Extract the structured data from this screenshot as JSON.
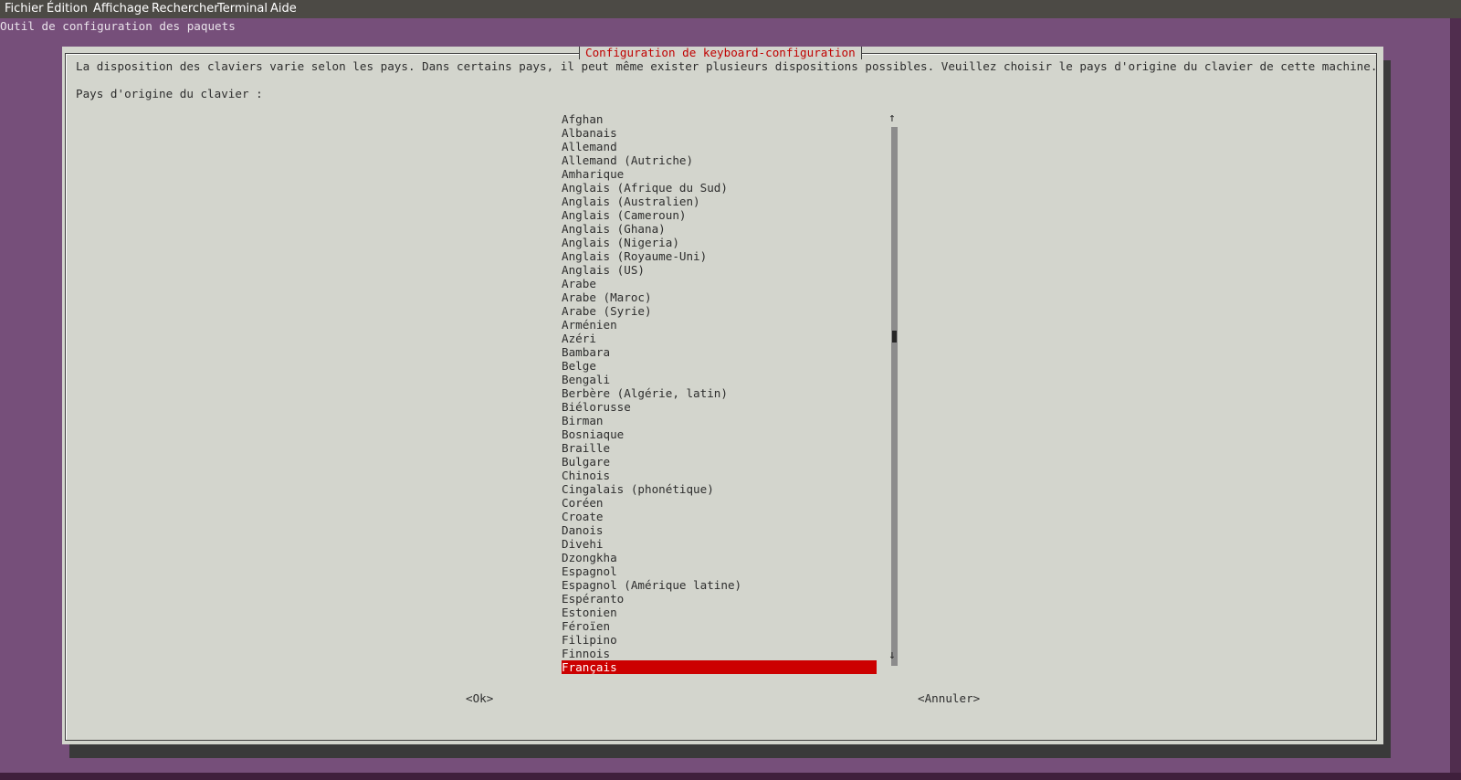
{
  "menubar": {
    "items": [
      "Fichier",
      "Édition",
      "Affichage",
      "Rechercher",
      "Terminal",
      "Aide"
    ]
  },
  "terminal": {
    "title": "Outil de configuration des paquets"
  },
  "dialog": {
    "title": "Configuration de keyboard-configuration",
    "description": "La disposition des claviers varie selon les pays. Dans certains pays, il peut même exister plusieurs dispositions possibles. Veuillez choisir le pays d'origine du clavier de cette machine.",
    "prompt": "Pays d'origine du clavier :",
    "countries": [
      "Afghan",
      "Albanais",
      "Allemand",
      "Allemand (Autriche)",
      "Amharique",
      "Anglais (Afrique du Sud)",
      "Anglais (Australien)",
      "Anglais (Cameroun)",
      "Anglais (Ghana)",
      "Anglais (Nigeria)",
      "Anglais (Royaume-Uni)",
      "Anglais (US)",
      "Arabe",
      "Arabe (Maroc)",
      "Arabe (Syrie)",
      "Arménien",
      "Azéri",
      "Bambara",
      "Belge",
      "Bengali",
      "Berbère (Algérie, latin)",
      "Biélorusse",
      "Birman",
      "Bosniaque",
      "Braille",
      "Bulgare",
      "Chinois",
      "Cingalais (phonétique)",
      "Coréen",
      "Croate",
      "Danois",
      "Divehi",
      "Dzongkha",
      "Espagnol",
      "Espagnol (Amérique latine)",
      "Espéranto",
      "Estonien",
      "Féroïen",
      "Filipino",
      "Finnois",
      "Français"
    ],
    "selected": "Français",
    "scroll_up_glyph": "↑",
    "scroll_down_glyph": "↓",
    "ok_label": "<Ok>",
    "cancel_label": "<Annuler>"
  },
  "colors": {
    "desktop": "#764f7a",
    "dialog_bg": "#d3d5cd",
    "title_color": "#c00000",
    "selection": "#cc0000"
  }
}
